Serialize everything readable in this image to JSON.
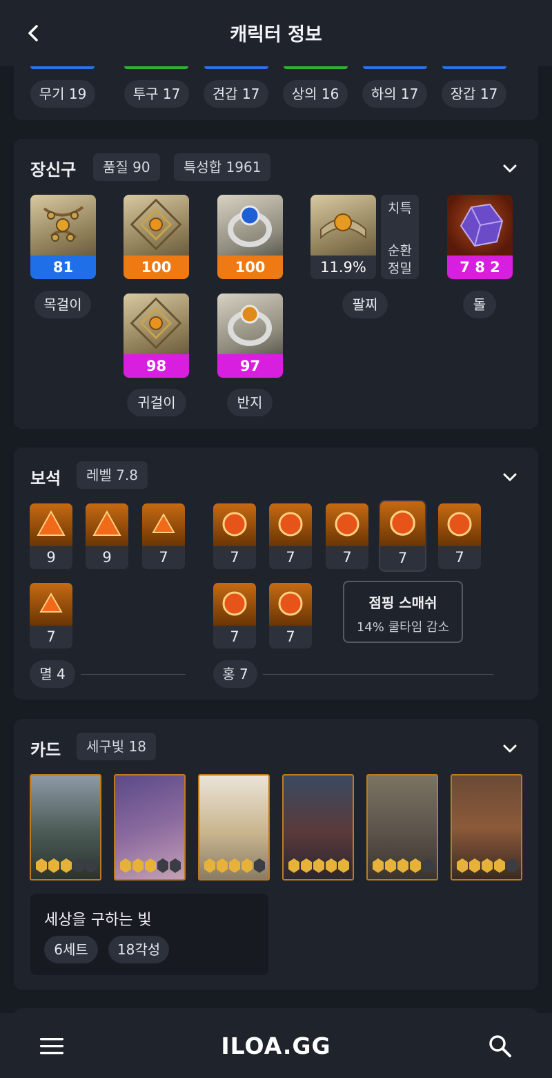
{
  "header": {
    "title": "캐릭터 정보"
  },
  "equipment": {
    "items": [
      {
        "label": "무기 19",
        "color": "#2b74e6"
      },
      {
        "label": "투구 17",
        "color": "#2bb52b"
      },
      {
        "label": "견갑 17",
        "color": "#2b74e6"
      },
      {
        "label": "상의 16",
        "color": "#2bb52b"
      },
      {
        "label": "하의 17",
        "color": "#2b74e6"
      },
      {
        "label": "장갑 17",
        "color": "#2b74e6"
      }
    ]
  },
  "accessories": {
    "title": "장신구",
    "quality_chip": "품질 90",
    "stat_chip": "특성합 1961",
    "necklace": {
      "value": "81",
      "label": "목걸이"
    },
    "earring1": {
      "value": "100"
    },
    "ring1": {
      "value": "100"
    },
    "earring2": {
      "value": "98"
    },
    "ring2": {
      "value": "97"
    },
    "earring_label": "귀걸이",
    "ring_label": "반지",
    "bracelet": {
      "value": "11.9%",
      "label": "팔찌",
      "stat1": "치특",
      "stat2": "순환",
      "stat3": "정밀"
    },
    "stone": {
      "value": "7 8 2",
      "label": "돌"
    },
    "colors": {
      "blue": "#1f6fe8",
      "orange": "#ef7a14",
      "magenta": "#d81fe0"
    }
  },
  "gems": {
    "title": "보석",
    "level_chip": "레벨 7.8",
    "left": [
      "9",
      "9",
      "7",
      "7"
    ],
    "right": [
      "7",
      "7",
      "7",
      "7",
      "7",
      "7",
      "7"
    ],
    "left_summary": "멸 4",
    "right_summary": "홍 7",
    "tooltip": {
      "title": "점핑 스매쉬",
      "desc": "14% 쿨타임 감소"
    }
  },
  "cards": {
    "title": "카드",
    "set_chip": "세구빛 18",
    "awakenings": [
      3,
      3,
      4,
      5,
      4,
      4
    ],
    "set_name": "세상을 구하는 빛",
    "tags": [
      "6세트",
      "18각성"
    ]
  },
  "footer": {
    "logo": "ILOA.GG"
  }
}
